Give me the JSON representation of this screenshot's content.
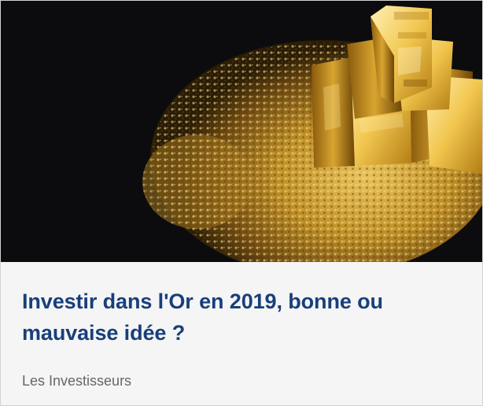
{
  "card": {
    "image_alt": "",
    "title": "Investir dans l'Or en 2019, bonne ou mauvaise idée ?",
    "source": "Les Investisseurs"
  },
  "colors": {
    "title": "#183f7a",
    "source": "#666666",
    "card_background": "#f5f5f5",
    "image_background": "#0c0c0e",
    "gold": "#c99a2e"
  },
  "icons": {
    "hero": "gold-bars-on-nuggets-photo"
  }
}
